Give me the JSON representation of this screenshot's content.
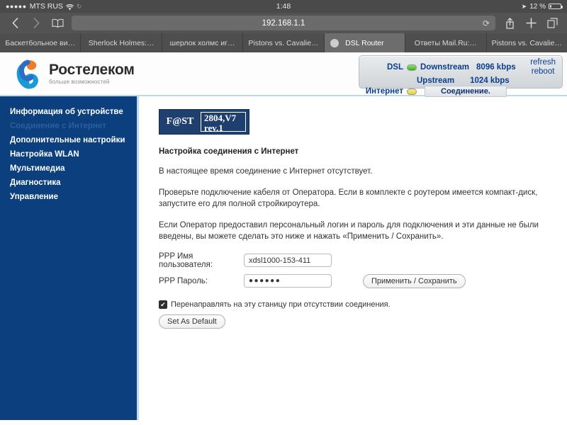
{
  "status_bar": {
    "signal_dots": "●●●●●",
    "carrier": "MTS RUS",
    "wifi_icon": "wifi-icon",
    "sync_icon": "sync-icon",
    "time": "1:48",
    "location_icon": "location-arrow-icon",
    "battery_percent": "12 %"
  },
  "browser": {
    "back_icon": "chevron-left-icon",
    "forward_icon": "chevron-right-icon",
    "bookmarks_icon": "book-icon",
    "url": "192.168.1.1",
    "reload_icon": "reload-icon",
    "share_icon": "share-icon",
    "new_tab_icon": "plus-icon",
    "tabs_icon": "tabs-icon",
    "tabs": [
      {
        "label": "Баскетбольное ви…",
        "active": false
      },
      {
        "label": "Sherlock Holmes:…",
        "active": false
      },
      {
        "label": "шерлок холмс иг…",
        "active": false
      },
      {
        "label": "Pistons vs. Cavalie…",
        "active": false
      },
      {
        "label": "DSL Router",
        "active": true,
        "close_icon": "close-icon"
      },
      {
        "label": "Ответы Mail.Ru:…",
        "active": false
      },
      {
        "label": "Pistons vs. Cavalie…",
        "active": false
      }
    ]
  },
  "router": {
    "brand": {
      "name": "Ростелеком",
      "tagline": "больше возможностей",
      "logo_icon": "rostelecom-logo-icon"
    },
    "status_panel": {
      "dsl_label": "DSL",
      "dsl_led_color": "#3fae20",
      "downstream_label": "Downstream",
      "downstream_value": "8096 kbps",
      "upstream_label": "Upstream",
      "upstream_value": "1024 kbps",
      "refresh_label": "refresh",
      "reboot_label": "reboot",
      "internet_label": "Интернет",
      "internet_led_color": "#e4d228",
      "connection_label": "Соединение."
    },
    "sidebar": {
      "items": [
        {
          "label": "Информация об устройстве",
          "current": false
        },
        {
          "label": "Соединение с Интернет",
          "current": true
        },
        {
          "label": "Дополнительные настройки",
          "current": false
        },
        {
          "label": "Настройка WLAN",
          "current": false
        },
        {
          "label": "Мультимедиа",
          "current": false
        },
        {
          "label": "Диагностика",
          "current": false
        },
        {
          "label": "Управление",
          "current": false
        }
      ]
    },
    "model_badge": {
      "brand": "F@ST",
      "model": "2804,V7",
      "revision": "rev.1"
    },
    "content": {
      "heading": "Настройка соединения с Интернет",
      "paragraph1": "В настоящее время соединение с Интернет отсутствует.",
      "paragraph2": "Проверьте подключение кабеля от Оператора. Если в комплекте с роутером имеется компакт-диск, запустите его для полной стройкироутера.",
      "paragraph3": "Если Оператор предоставил персональный логин и пароль для подключения и эти данные не были введены, вы можете сделать это ниже и нажать «Применить / Сохранить».",
      "username_label": "PPP Имя пользователя:",
      "username_value": "xdsl1000-153-411",
      "password_label": "PPP Пароль:",
      "password_value": "●●●●●●",
      "apply_button": "Применить / Сохранить",
      "redirect_checkbox_label": "Перенаправлять на эту станицу при отсутствии соединения.",
      "redirect_checkbox_checked": "✔",
      "set_default_button": "Set As Default"
    }
  },
  "colors": {
    "sidebar_navy": "#0b3f7e",
    "accent_blue": "#bcd9ef",
    "badge_navy": "#1f3f6e"
  }
}
